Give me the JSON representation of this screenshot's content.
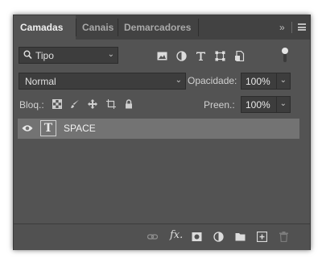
{
  "tabs": [
    {
      "label": "Camadas",
      "active": true
    },
    {
      "label": "Canais",
      "active": false
    },
    {
      "label": "Demarcadores",
      "active": false
    }
  ],
  "panel": {
    "collapse_label": "»"
  },
  "filter": {
    "kind_label": "Tipo",
    "icons": [
      "image-filter-icon",
      "adjustment-filter-icon",
      "type-filter-icon",
      "shape-filter-icon",
      "smart-object-filter-icon"
    ]
  },
  "blend": {
    "mode": "Normal",
    "opacity_label": "Opacidade:",
    "opacity_value": "100%"
  },
  "lock": {
    "label": "Bloq.:",
    "icons": [
      "lock-transparent-pixels-icon",
      "lock-image-pixels-icon",
      "lock-position-icon",
      "lock-artboard-icon",
      "lock-all-icon"
    ],
    "fill_label": "Preen.:",
    "fill_value": "100%"
  },
  "layers": [
    {
      "name": "SPACE",
      "type": "text",
      "visible": true,
      "selected": true
    }
  ],
  "footer_icons": [
    "link-layers-icon",
    "fx-icon",
    "add-mask-icon",
    "new-adjustment-icon",
    "new-group-icon",
    "new-layer-icon",
    "delete-icon"
  ],
  "colors": {
    "panel": "#535353",
    "tabbar": "#424242",
    "selected_row": "#737373",
    "field": "#3d3d3d"
  }
}
